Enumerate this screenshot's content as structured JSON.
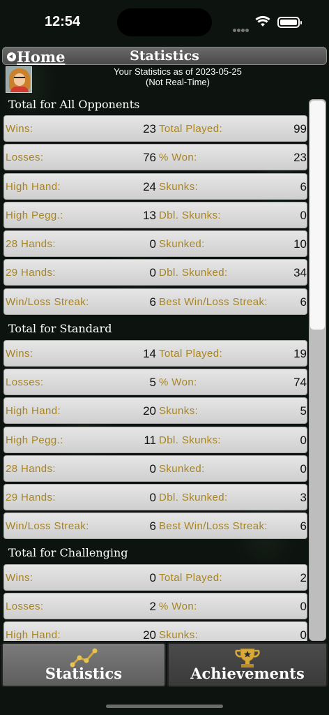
{
  "status": {
    "time": "12:54"
  },
  "nav": {
    "back_label": "Home",
    "title": "Statistics"
  },
  "header": {
    "as_of": "Your Statistics as of 2023-05-25",
    "note": "(Not Real-Time)"
  },
  "sections": [
    {
      "title": "Total for All Opponents",
      "rows": [
        {
          "l_label": "Wins:",
          "l_value": "23",
          "r_label": "Total Played:",
          "r_value": "99"
        },
        {
          "l_label": "Losses:",
          "l_value": "76",
          "r_label": "% Won:",
          "r_value": "23"
        },
        {
          "l_label": "High Hand:",
          "l_value": "24",
          "r_label": "Skunks:",
          "r_value": "6"
        },
        {
          "l_label": "High Pegg.:",
          "l_value": "13",
          "r_label": "Dbl. Skunks:",
          "r_value": "0"
        },
        {
          "l_label": "28 Hands:",
          "l_value": "0",
          "r_label": "Skunked:",
          "r_value": "10"
        },
        {
          "l_label": "29 Hands:",
          "l_value": "0",
          "r_label": "Dbl. Skunked:",
          "r_value": "34"
        },
        {
          "l_label": "Win/Loss Streak:",
          "l_value": "6",
          "r_label": "Best Win/Loss Streak:",
          "r_value": "6"
        }
      ]
    },
    {
      "title": "Total for Standard",
      "rows": [
        {
          "l_label": "Wins:",
          "l_value": "14",
          "r_label": "Total Played:",
          "r_value": "19"
        },
        {
          "l_label": "Losses:",
          "l_value": "5",
          "r_label": "% Won:",
          "r_value": "74"
        },
        {
          "l_label": "High Hand:",
          "l_value": "20",
          "r_label": "Skunks:",
          "r_value": "5"
        },
        {
          "l_label": "High Pegg.:",
          "l_value": "11",
          "r_label": "Dbl. Skunks:",
          "r_value": "0"
        },
        {
          "l_label": "28 Hands:",
          "l_value": "0",
          "r_label": "Skunked:",
          "r_value": "0"
        },
        {
          "l_label": "29 Hands:",
          "l_value": "0",
          "r_label": "Dbl. Skunked:",
          "r_value": "3"
        },
        {
          "l_label": "Win/Loss Streak:",
          "l_value": "6",
          "r_label": "Best Win/Loss Streak:",
          "r_value": "6"
        }
      ]
    },
    {
      "title": "Total for Challenging",
      "rows": [
        {
          "l_label": "Wins:",
          "l_value": "0",
          "r_label": "Total Played:",
          "r_value": "2"
        },
        {
          "l_label": "Losses:",
          "l_value": "2",
          "r_label": "% Won:",
          "r_value": "0"
        },
        {
          "l_label": "High Hand:",
          "l_value": "20",
          "r_label": "Skunks:",
          "r_value": "0"
        }
      ]
    }
  ],
  "tabs": [
    {
      "label": "Statistics",
      "icon": "line-chart-icon"
    },
    {
      "label": "Achievements",
      "icon": "trophy-icon"
    }
  ],
  "colors": {
    "label_gold": "#a78422",
    "row_bg": "#dcdcdc",
    "nav_bg": "#5a5a5a",
    "page_bg": "#0d130f"
  }
}
